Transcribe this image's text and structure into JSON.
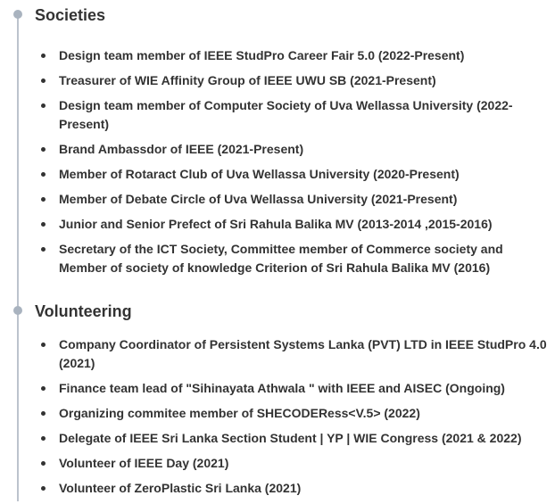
{
  "societies": {
    "title": "Societies",
    "items": [
      "Design team member of IEEE StudPro Career Fair 5.0 (2022-Present)",
      "Treasurer of WIE Affinity Group of IEEE UWU SB (2021-Present)",
      "Design team member of Computer Society of Uva Wellassa University (2022-Present)",
      "Brand Ambassdor of IEEE (2021-Present)",
      "Member of Rotaract Club of Uva Wellassa University (2020-Present)",
      "Member of Debate Circle of Uva Wellassa University (2021-Present)",
      "Junior and Senior Prefect of Sri Rahula Balika MV (2013-2014 ,2015-2016)",
      "Secretary of the ICT Society, Committee member of Commerce society and Member of society of knowledge Criterion of Sri Rahula Balika MV (2016)"
    ]
  },
  "volunteering": {
    "title": "Volunteering",
    "items": [
      "Company Coordinator of Persistent Systems Lanka (PVT) LTD in IEEE StudPro 4.0 (2021)",
      "Finance team lead of \"Sihinayata Athwala \" with IEEE and AISEC  (Ongoing)",
      "Organizing commitee member of SHECODERess<V.5> (2022)",
      "Delegate of IEEE Sri Lanka Section Student |  YP | WIE Congress (2021 & 2022)",
      "Volunteer of IEEE Day (2021)",
      "Volunteer of ZeroPlastic Sri Lanka (2021)"
    ]
  }
}
